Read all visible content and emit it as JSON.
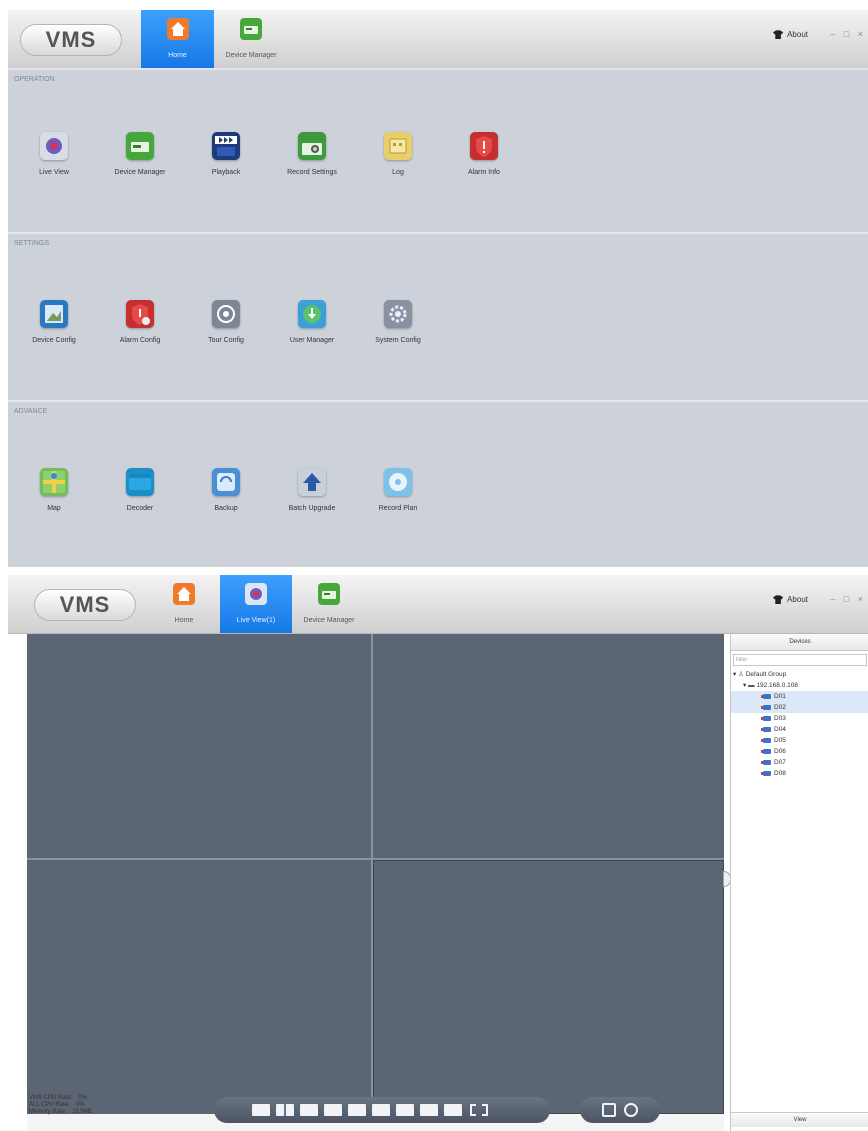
{
  "home_screen": {
    "logo": "VMS",
    "tabs": [
      {
        "label": "Home",
        "icon": "home-icon",
        "active": true
      },
      {
        "label": "Device Manager",
        "icon": "device-manager-icon",
        "active": false
      }
    ],
    "about": "About",
    "window_controls": "– □ ×",
    "sections": [
      {
        "title": "OPERATION",
        "items": [
          {
            "label": "Live View",
            "icon": "live-view-icon"
          },
          {
            "label": "Device Manager",
            "icon": "device-manager-icon"
          },
          {
            "label": "Playback",
            "icon": "playback-icon"
          },
          {
            "label": "Record Settings",
            "icon": "record-settings-icon"
          },
          {
            "label": "Log",
            "icon": "log-icon"
          },
          {
            "label": "Alarm Info",
            "icon": "alarm-info-icon"
          }
        ]
      },
      {
        "title": "SETTINGS",
        "items": [
          {
            "label": "Device Config",
            "icon": "device-config-icon"
          },
          {
            "label": "Alarm Config",
            "icon": "alarm-config-icon"
          },
          {
            "label": "Tour Config",
            "icon": "tour-config-icon"
          },
          {
            "label": "User Manager",
            "icon": "user-manager-icon"
          },
          {
            "label": "System Config",
            "icon": "system-config-icon"
          }
        ]
      },
      {
        "title": "ADVANCE",
        "items": [
          {
            "label": "Map",
            "icon": "map-icon"
          },
          {
            "label": "Decoder",
            "icon": "decoder-icon"
          },
          {
            "label": "Backup",
            "icon": "backup-icon"
          },
          {
            "label": "Batch Upgrade",
            "icon": "batch-upgrade-icon"
          },
          {
            "label": "Record Plan",
            "icon": "record-plan-icon"
          }
        ]
      }
    ]
  },
  "live_screen": {
    "logo": "VMS",
    "tabs": [
      {
        "label": "Home",
        "icon": "home-icon",
        "active": false
      },
      {
        "label": "Live View(1)",
        "icon": "live-view-icon",
        "active": true
      },
      {
        "label": "Device Manager",
        "icon": "device-manager-icon",
        "active": false
      }
    ],
    "about": "About",
    "window_controls": "– □ ×",
    "stats": [
      {
        "label": "VMS CPU Rate:",
        "value": "0%"
      },
      {
        "label": "ALL CPU Rate:",
        "value": "0%"
      },
      {
        "label": "Memory Rate:",
        "value": "212MB"
      }
    ],
    "devices_panel": {
      "title": "Devices",
      "filter_placeholder": "Filter",
      "group": "Default Group",
      "device": "192.168.0.108",
      "channels": [
        "D01",
        "D02",
        "D03",
        "D04",
        "D05",
        "D06",
        "D07",
        "D08"
      ],
      "selected_channels": [
        "D01",
        "D02"
      ],
      "footer": "View"
    },
    "layout_buttons": [
      "1-split",
      "4-split",
      "6-split",
      "8-split",
      "9-split",
      "16-split",
      "25-split",
      "36-split",
      "64-split",
      "fullscreen"
    ],
    "snapshot_buttons": [
      "save-icon",
      "snapshot-icon"
    ]
  },
  "colors": {
    "accent_tab": "#1a7fe8",
    "home_bg": "#cdd2da",
    "video_bg": "#5c6573",
    "selection": "#dbe8f7"
  }
}
